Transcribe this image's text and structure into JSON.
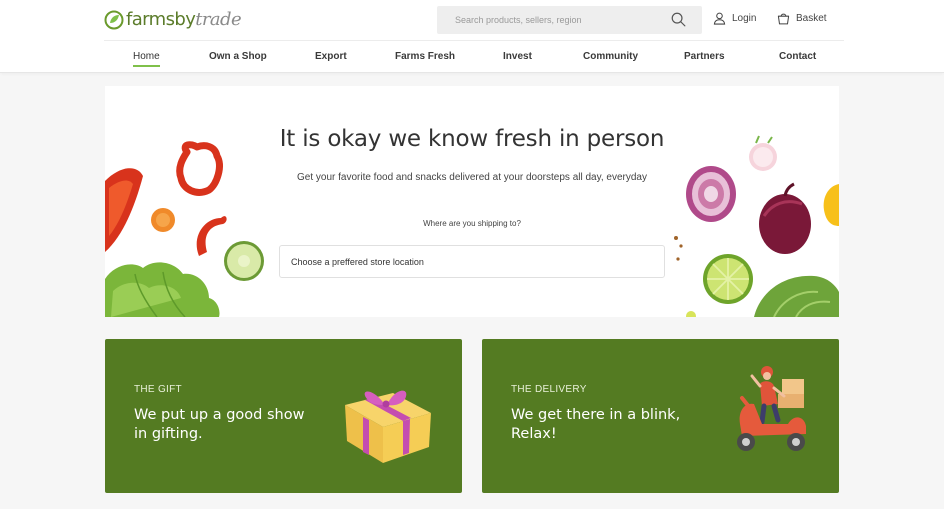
{
  "brand": {
    "name_part1": "farmsby",
    "name_part2": "trade"
  },
  "search": {
    "placeholder": "Search products, sellers, region"
  },
  "account": {
    "login_label": "Login",
    "basket_label": "Basket"
  },
  "nav": {
    "items": [
      {
        "label": "Home",
        "active": true
      },
      {
        "label": "Own a Shop"
      },
      {
        "label": "Export"
      },
      {
        "label": "Farms Fresh"
      },
      {
        "label": "Invest"
      },
      {
        "label": "Community"
      },
      {
        "label": "Partners"
      },
      {
        "label": "Contact"
      }
    ]
  },
  "hero": {
    "title": "It is okay we know fresh in person",
    "subtitle": "Get your favorite food and snacks delivered at your doorsteps all day, everyday",
    "location_label": "Where are you shipping to?",
    "location_placeholder": "Choose a preffered store location"
  },
  "cards": [
    {
      "eyebrow": "THE GIFT",
      "title": "We put up a good show in gifting."
    },
    {
      "eyebrow": "THE DELIVERY",
      "title": "We get there in a blink, Relax!"
    }
  ],
  "colors": {
    "accent": "#547b22",
    "nav_underline": "#7fc04a",
    "logo_green": "#5b7c2a"
  }
}
